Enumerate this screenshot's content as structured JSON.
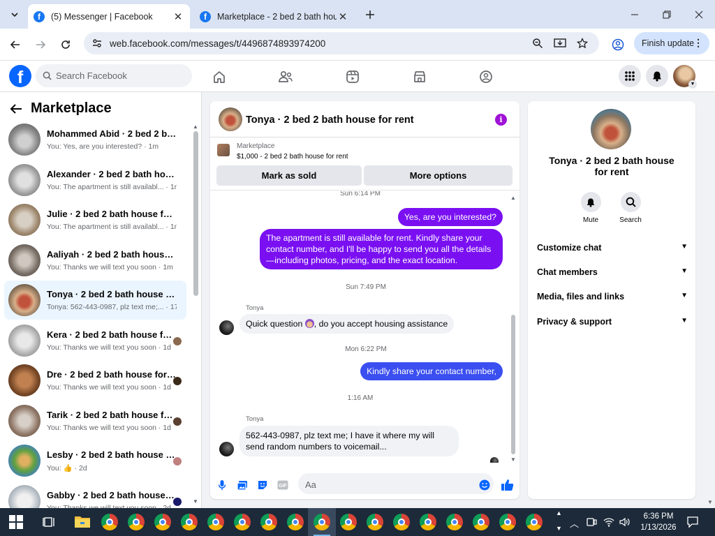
{
  "browser": {
    "tabs": [
      {
        "title": "(5) Messenger | Facebook",
        "active": true
      },
      {
        "title": "Marketplace - 2 bed 2 bath hou",
        "active": false
      }
    ],
    "url": "web.facebook.com/messages/t/4496874893974200",
    "finish_update_label": "Finish update"
  },
  "fb": {
    "logo": "f",
    "search_placeholder": "Search Facebook"
  },
  "sidebar": {
    "title": "Marketplace",
    "conversations": [
      {
        "name": "Mohammed Abid · 2 bed 2 bath...",
        "preview": "You: Yes, are you interested? · 1m",
        "active": false
      },
      {
        "name": "Alexander · 2 bed 2 bath house ...",
        "preview": "You: The apartment is still availabl... · 1m",
        "active": false
      },
      {
        "name": "Julie · 2 bed 2 bath house for rent",
        "preview": "You: The apartment is still availabl... · 1m",
        "active": false
      },
      {
        "name": "Aaliyah · 2 bed 2 bath house for...",
        "preview": "You: Thanks we will text you soon · 1m",
        "active": false
      },
      {
        "name": "Tonya · 2 bed 2 bath house for r...",
        "preview": "Tonya: 562-443-0987, plz text me;... · 17h",
        "active": true
      },
      {
        "name": "Kera · 2 bed 2 bath house for ...",
        "preview": "You: Thanks we will text you soon · 1d",
        "active": false
      },
      {
        "name": "Dre · 2 bed 2 bath house for r...",
        "preview": "You: Thanks we will text you soon · 1d",
        "active": false
      },
      {
        "name": "Tarik · 2 bed 2 bath house for...",
        "preview": "You: Thanks we will text you soon · 1d",
        "active": false
      },
      {
        "name": "Lesby · 2 bed 2 bath house fo...",
        "preview": "You: 👍 · 2d",
        "active": false
      },
      {
        "name": "Gabby · 2 bed 2 bath house f...",
        "preview": "You: Thanks we will text you soon · 2d",
        "active": false
      }
    ]
  },
  "chat": {
    "title": "Tonya · 2 bed 2 bath house for rent",
    "marketplace_label": "Marketplace",
    "listing": "$1,000 - 2 bed 2 bath house for rent",
    "mark_sold_label": "Mark as sold",
    "more_options_label": "More options",
    "ts1": "Sun 6:14 PM",
    "out1": "Yes, are you interested?",
    "out2": "The apartment is still available for rent. Kindly share your contact number, and I'll be happy to send you all the details—including photos, pricing, and the exact location.",
    "ts2": "Sun 7:49 PM",
    "sender1": "Tonya",
    "in1_a": "Quick question",
    "in1_b": ", do you accept housing assistance",
    "ts3": "Mon 6:22 PM",
    "out3": "Kindly share your contact number,",
    "ts4": "1:16 AM",
    "sender2": "Tonya",
    "in2": "562-443-0987, plz text me; I have it where my will send random numbers to voicemail...",
    "composer_placeholder": "Aa"
  },
  "info": {
    "name": "Tonya · 2 bed 2 bath house for rent",
    "mute_label": "Mute",
    "search_label": "Search",
    "sections": [
      "Customize chat",
      "Chat members",
      "Media, files and links",
      "Privacy & support"
    ]
  },
  "taskbar": {
    "time": "6:36 PM",
    "date": "1/13/2026"
  },
  "colors": {
    "accent_purple": "#7a10f2",
    "messenger_blue": "#3b4ff0",
    "facebook_blue": "#0866ff"
  }
}
